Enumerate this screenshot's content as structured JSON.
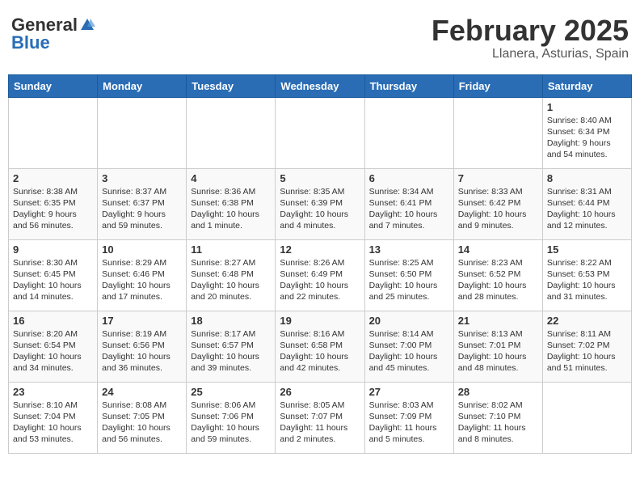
{
  "header": {
    "logo_general": "General",
    "logo_blue": "Blue",
    "month": "February 2025",
    "location": "Llanera, Asturias, Spain"
  },
  "weekdays": [
    "Sunday",
    "Monday",
    "Tuesday",
    "Wednesday",
    "Thursday",
    "Friday",
    "Saturday"
  ],
  "weeks": [
    [
      {
        "day": "",
        "info": ""
      },
      {
        "day": "",
        "info": ""
      },
      {
        "day": "",
        "info": ""
      },
      {
        "day": "",
        "info": ""
      },
      {
        "day": "",
        "info": ""
      },
      {
        "day": "",
        "info": ""
      },
      {
        "day": "1",
        "info": "Sunrise: 8:40 AM\nSunset: 6:34 PM\nDaylight: 9 hours and 54 minutes."
      }
    ],
    [
      {
        "day": "2",
        "info": "Sunrise: 8:38 AM\nSunset: 6:35 PM\nDaylight: 9 hours and 56 minutes."
      },
      {
        "day": "3",
        "info": "Sunrise: 8:37 AM\nSunset: 6:37 PM\nDaylight: 9 hours and 59 minutes."
      },
      {
        "day": "4",
        "info": "Sunrise: 8:36 AM\nSunset: 6:38 PM\nDaylight: 10 hours and 1 minute."
      },
      {
        "day": "5",
        "info": "Sunrise: 8:35 AM\nSunset: 6:39 PM\nDaylight: 10 hours and 4 minutes."
      },
      {
        "day": "6",
        "info": "Sunrise: 8:34 AM\nSunset: 6:41 PM\nDaylight: 10 hours and 7 minutes."
      },
      {
        "day": "7",
        "info": "Sunrise: 8:33 AM\nSunset: 6:42 PM\nDaylight: 10 hours and 9 minutes."
      },
      {
        "day": "8",
        "info": "Sunrise: 8:31 AM\nSunset: 6:44 PM\nDaylight: 10 hours and 12 minutes."
      }
    ],
    [
      {
        "day": "9",
        "info": "Sunrise: 8:30 AM\nSunset: 6:45 PM\nDaylight: 10 hours and 14 minutes."
      },
      {
        "day": "10",
        "info": "Sunrise: 8:29 AM\nSunset: 6:46 PM\nDaylight: 10 hours and 17 minutes."
      },
      {
        "day": "11",
        "info": "Sunrise: 8:27 AM\nSunset: 6:48 PM\nDaylight: 10 hours and 20 minutes."
      },
      {
        "day": "12",
        "info": "Sunrise: 8:26 AM\nSunset: 6:49 PM\nDaylight: 10 hours and 22 minutes."
      },
      {
        "day": "13",
        "info": "Sunrise: 8:25 AM\nSunset: 6:50 PM\nDaylight: 10 hours and 25 minutes."
      },
      {
        "day": "14",
        "info": "Sunrise: 8:23 AM\nSunset: 6:52 PM\nDaylight: 10 hours and 28 minutes."
      },
      {
        "day": "15",
        "info": "Sunrise: 8:22 AM\nSunset: 6:53 PM\nDaylight: 10 hours and 31 minutes."
      }
    ],
    [
      {
        "day": "16",
        "info": "Sunrise: 8:20 AM\nSunset: 6:54 PM\nDaylight: 10 hours and 34 minutes."
      },
      {
        "day": "17",
        "info": "Sunrise: 8:19 AM\nSunset: 6:56 PM\nDaylight: 10 hours and 36 minutes."
      },
      {
        "day": "18",
        "info": "Sunrise: 8:17 AM\nSunset: 6:57 PM\nDaylight: 10 hours and 39 minutes."
      },
      {
        "day": "19",
        "info": "Sunrise: 8:16 AM\nSunset: 6:58 PM\nDaylight: 10 hours and 42 minutes."
      },
      {
        "day": "20",
        "info": "Sunrise: 8:14 AM\nSunset: 7:00 PM\nDaylight: 10 hours and 45 minutes."
      },
      {
        "day": "21",
        "info": "Sunrise: 8:13 AM\nSunset: 7:01 PM\nDaylight: 10 hours and 48 minutes."
      },
      {
        "day": "22",
        "info": "Sunrise: 8:11 AM\nSunset: 7:02 PM\nDaylight: 10 hours and 51 minutes."
      }
    ],
    [
      {
        "day": "23",
        "info": "Sunrise: 8:10 AM\nSunset: 7:04 PM\nDaylight: 10 hours and 53 minutes."
      },
      {
        "day": "24",
        "info": "Sunrise: 8:08 AM\nSunset: 7:05 PM\nDaylight: 10 hours and 56 minutes."
      },
      {
        "day": "25",
        "info": "Sunrise: 8:06 AM\nSunset: 7:06 PM\nDaylight: 10 hours and 59 minutes."
      },
      {
        "day": "26",
        "info": "Sunrise: 8:05 AM\nSunset: 7:07 PM\nDaylight: 11 hours and 2 minutes."
      },
      {
        "day": "27",
        "info": "Sunrise: 8:03 AM\nSunset: 7:09 PM\nDaylight: 11 hours and 5 minutes."
      },
      {
        "day": "28",
        "info": "Sunrise: 8:02 AM\nSunset: 7:10 PM\nDaylight: 11 hours and 8 minutes."
      },
      {
        "day": "",
        "info": ""
      }
    ]
  ]
}
